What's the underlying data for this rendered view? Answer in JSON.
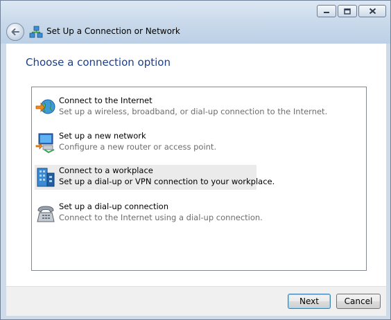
{
  "window": {
    "title": "Set Up a Connection or Network",
    "controls": {
      "minimize_icon": "minimize-icon",
      "maximize_icon": "maximize-icon",
      "close_icon": "close-icon"
    }
  },
  "heading": "Choose a connection option",
  "options": [
    {
      "title": "Connect to the Internet",
      "description": "Set up a wireless, broadband, or dial-up connection to the Internet.",
      "icon": "internet-globe-icon"
    },
    {
      "title": "Set up a new network",
      "description": "Configure a new router or access point.",
      "icon": "new-network-icon"
    },
    {
      "title": "Connect to a workplace",
      "description": "Set up a dial-up or VPN connection to your workplace.",
      "icon": "workplace-building-icon",
      "selected": true
    },
    {
      "title": "Set up a dial-up connection",
      "description": "Connect to the Internet using a dial-up connection.",
      "icon": "dialup-telephone-icon"
    }
  ],
  "buttons": {
    "next": "Next",
    "cancel": "Cancel"
  }
}
